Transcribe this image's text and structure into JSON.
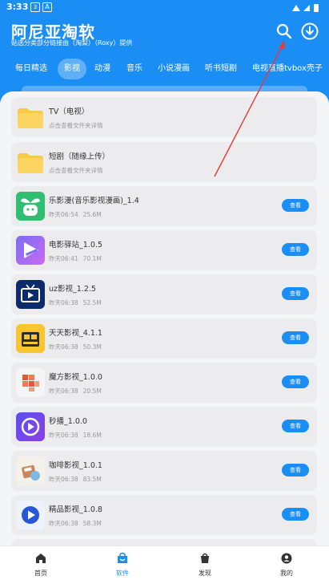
{
  "status_bar": {
    "time": "3:33",
    "notif_1": "3",
    "notif_2": "A"
  },
  "app": {
    "title": "阿尼亚淘软",
    "subtitle": "贴选分类部分链接由（淘梨）（Roxy）提供"
  },
  "tabs": [
    {
      "label": "每日精选",
      "active": false
    },
    {
      "label": "影视",
      "active": true
    },
    {
      "label": "动漫",
      "active": false
    },
    {
      "label": "音乐",
      "active": false
    },
    {
      "label": "小说漫画",
      "active": false
    },
    {
      "label": "听书短剧",
      "active": false
    },
    {
      "label": "电视直播tvbox壳子",
      "active": false
    }
  ],
  "folders": [
    {
      "name": "TV（电视）",
      "hint": "点击查看文件夹详情"
    },
    {
      "name": "短剧（随缘上传）",
      "hint": "点击查看文件夹详情"
    }
  ],
  "apps": [
    {
      "name": "乐影漫(音乐影视漫画)_1.4",
      "time": "昨天06:54",
      "size": "25.6M",
      "icon": "sprout-icon"
    },
    {
      "name": "电影驿站_1.0.5",
      "time": "昨天06:41",
      "size": "70.1M",
      "icon": "ticket-icon"
    },
    {
      "name": "uz影视_1.2.5",
      "time": "昨天06:38",
      "size": "52.5M",
      "icon": "tv-icon"
    },
    {
      "name": "天天影视_4.1.1",
      "time": "昨天06:38",
      "size": "50.3M",
      "icon": "clapper-icon"
    },
    {
      "name": "魔方影视_1.0.0",
      "time": "昨天06:38",
      "size": "20.5M",
      "icon": "cube-icon"
    },
    {
      "name": "秒播_1.0.0",
      "time": "昨天06:38",
      "size": "18.6M",
      "icon": "play-hex-icon"
    },
    {
      "name": "咖啡影视_1.0.1",
      "time": "昨天06:38",
      "size": "83.5M",
      "icon": "coffee-icon"
    },
    {
      "name": "精品影视_1.0.8",
      "time": "昨天06:38",
      "size": "58.3M",
      "icon": "play-circle-icon"
    }
  ],
  "view_label": "查看",
  "bottom_nav": [
    {
      "label": "首页",
      "active": false
    },
    {
      "label": "软件",
      "active": true
    },
    {
      "label": "发现",
      "active": false
    },
    {
      "label": "我的",
      "active": false
    }
  ]
}
